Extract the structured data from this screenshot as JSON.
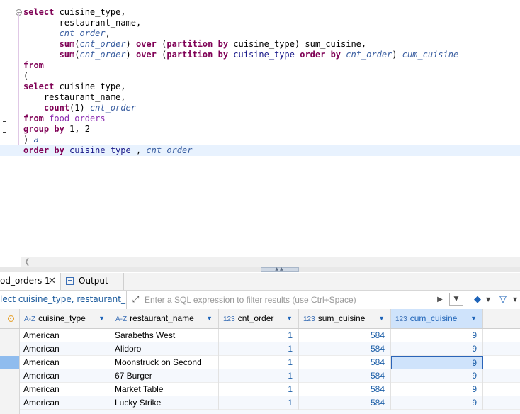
{
  "editor": {
    "lines": [
      [
        [
          "kw",
          "select"
        ],
        [
          "plain",
          " cuisine_type,"
        ]
      ],
      [
        [
          "plain",
          "       restaurant_name,"
        ]
      ],
      [
        [
          "plain",
          "       "
        ],
        [
          "col",
          "cnt_order"
        ],
        [
          "plain",
          ","
        ]
      ],
      [
        [
          "plain",
          "       "
        ],
        [
          "kw",
          "sum"
        ],
        [
          "plain",
          "("
        ],
        [
          "col",
          "cnt_order"
        ],
        [
          "plain",
          ") "
        ],
        [
          "kw",
          "over"
        ],
        [
          "plain",
          " ("
        ],
        [
          "kw",
          "partition by"
        ],
        [
          "plain",
          " cuisine_type) sum_cuisine,"
        ]
      ],
      [
        [
          "plain",
          "       "
        ],
        [
          "kw",
          "sum"
        ],
        [
          "plain",
          "("
        ],
        [
          "col",
          "cnt_order"
        ],
        [
          "plain",
          ") "
        ],
        [
          "kw",
          "over"
        ],
        [
          "plain",
          " ("
        ],
        [
          "kw",
          "partition by"
        ],
        [
          "plain",
          " "
        ],
        [
          "fn",
          "cuisine_type"
        ],
        [
          "plain",
          " "
        ],
        [
          "kw",
          "order by"
        ],
        [
          "plain",
          " "
        ],
        [
          "col",
          "cnt_order"
        ],
        [
          "plain",
          ") "
        ],
        [
          "col",
          "cum_cuisine"
        ]
      ],
      [
        [
          "kw",
          "from"
        ]
      ],
      [
        [
          "plain",
          "("
        ]
      ],
      [
        [
          "kw",
          "select"
        ],
        [
          "plain",
          " cuisine_type,"
        ]
      ],
      [
        [
          "plain",
          "    restaurant_name,"
        ]
      ],
      [
        [
          "plain",
          "    "
        ],
        [
          "kw",
          "count"
        ],
        [
          "plain",
          "(1) "
        ],
        [
          "col",
          "cnt_order"
        ]
      ],
      [
        [
          "kw",
          "from"
        ],
        [
          "plain",
          " "
        ],
        [
          "tbl",
          "food_orders"
        ]
      ],
      [
        [
          "kw",
          "group by"
        ],
        [
          "plain",
          " 1, 2"
        ]
      ],
      [
        [
          "plain",
          ") "
        ],
        [
          "col",
          "a"
        ]
      ],
      [
        [
          "kw",
          "order by"
        ],
        [
          "plain",
          " "
        ],
        [
          "fn",
          "cuisine_type"
        ],
        [
          "plain",
          " , "
        ],
        [
          "col",
          "cnt_order"
        ]
      ]
    ],
    "current_line_index": 13
  },
  "tabs": {
    "results_label": "od_orders 1",
    "output_label": "Output"
  },
  "filter": {
    "query_text": "lect cuisine_type, restaurant_nam",
    "placeholder": "Enter a SQL expression to filter results (use Ctrl+Space)"
  },
  "grid": {
    "columns": [
      {
        "label": "cuisine_type",
        "type_icon": "A-Z"
      },
      {
        "label": "restaurant_name",
        "type_icon": "A-Z"
      },
      {
        "label": "cnt_order",
        "type_icon": "123"
      },
      {
        "label": "sum_cuisine",
        "type_icon": "123"
      },
      {
        "label": "cum_cuisine",
        "type_icon": "123"
      }
    ],
    "rows": [
      [
        "American",
        "Sarabeths West",
        "1",
        "584",
        "9"
      ],
      [
        "American",
        "Alidoro",
        "1",
        "584",
        "9"
      ],
      [
        "American",
        "Moonstruck on Second",
        "1",
        "584",
        "9"
      ],
      [
        "American",
        "67 Burger",
        "1",
        "584",
        "9"
      ],
      [
        "American",
        "Market Table",
        "1",
        "584",
        "9"
      ],
      [
        "American",
        "Lucky Strike",
        "1",
        "584",
        "9"
      ]
    ],
    "current_row_index": 2,
    "selected_column_index": 4
  }
}
